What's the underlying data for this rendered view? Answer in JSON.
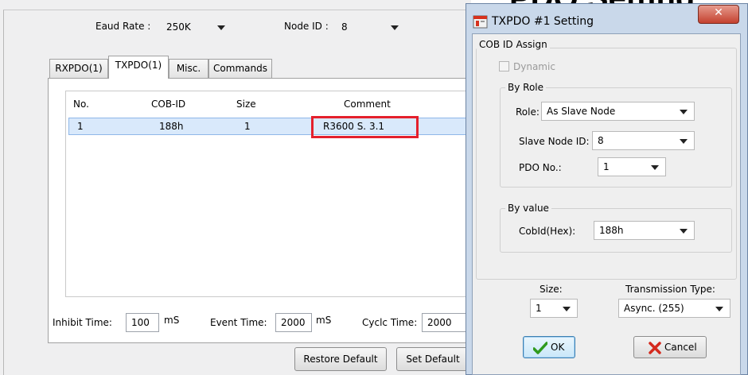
{
  "main": {
    "baud_rate_label": "Eaud Rate :",
    "baud_rate_value": "250K",
    "node_id_label": "Node ID :",
    "node_id_value": "8",
    "tabs": [
      {
        "label": "RXPDO(1)"
      },
      {
        "label": "TXPDO(1)"
      },
      {
        "label": "Misc."
      },
      {
        "label": "Commands"
      }
    ],
    "table": {
      "headers": [
        "No.",
        "COB-ID",
        "Size",
        "Comment"
      ],
      "rows": [
        {
          "no": "1",
          "cob_id": "188h",
          "size": "1",
          "comment": "R3600 S. 3.1"
        }
      ]
    },
    "inhibit_time_label": "Inhibit Time:",
    "inhibit_time_value": "100",
    "inhibit_time_unit": "mS",
    "event_time_label": "Event Time:",
    "event_time_value": "2000",
    "event_time_unit": "mS",
    "cycle_time_label": "Cyclc Time:",
    "cycle_time_value": "2000",
    "restore_default_label": "Restore Default",
    "set_default_label": "Set Default"
  },
  "dialog": {
    "title": "TXPDO #1 Setting",
    "close_symbol": "✕",
    "cob_id_assign_label": "COB ID Assign",
    "dynamic_label": "Dynamic",
    "dynamic_checked": false,
    "by_role_label": "By Role",
    "role_label": "Role:",
    "role_value": "As Slave Node",
    "slave_node_id_label": "Slave Node ID:",
    "slave_node_id_value": "8",
    "pdo_no_label": "PDO No.:",
    "pdo_no_value": "1",
    "by_value_label": "By value",
    "cobid_hex_label": "CobId(Hex):",
    "cobid_hex_value": "188h",
    "size_label": "Size:",
    "size_value": "1",
    "transmission_type_label": "Transmission Type:",
    "transmission_type_value": "Async. (255)",
    "ok_label": "OK",
    "cancel_label": "Cancel"
  },
  "colors": {
    "highlight_box": "#e4202c",
    "selected_row": "#d9e9fb",
    "ok_check": "#2f9a1d",
    "cancel_x": "#d42a1e",
    "dialog_frame": "#c9d8ea"
  }
}
